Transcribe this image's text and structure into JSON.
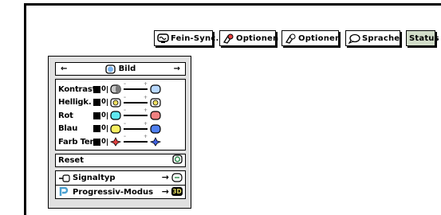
{
  "tabs": [
    {
      "id": "fein-sync",
      "label": "Fein-Sync.",
      "icon": "monitor-sync-icon"
    },
    {
      "id": "optionen1",
      "label": "Optionen",
      "icon": "tools-icon"
    },
    {
      "id": "optionen2",
      "label": "Optionen",
      "icon": "tools-icon"
    },
    {
      "id": "sprache",
      "label": "Sprache",
      "icon": "speech-bubble-icon"
    },
    {
      "id": "status",
      "label": "Status",
      "icon": ""
    }
  ],
  "menu": {
    "title": "Bild",
    "left_arrow": "←",
    "right_arrow": "→",
    "rows": [
      {
        "label": "Kontrast",
        "value": "0",
        "icon": "contrast-icon",
        "color": "#c8c8c8",
        "icon2_color": "#b8d8ff"
      },
      {
        "label": "Helligk.",
        "value": "0",
        "icon": "brightness-icon",
        "color": "#f0e060",
        "icon2_color": "#f0e060"
      },
      {
        "label": "Rot",
        "value": "0",
        "icon": "red-cyan-icon",
        "color": "#60e8f0",
        "icon2_color": "#f08080"
      },
      {
        "label": "Blau",
        "value": "0",
        "icon": "blue-yellow-icon",
        "color": "#f8f060",
        "icon2_color": "#5080f0"
      },
      {
        "label": "Farb Temp",
        "value": "0",
        "icon": "color-temp-icon",
        "color": "#e04040",
        "icon2_color": "#4060e0"
      }
    ],
    "reset_label": "Reset",
    "signaltyp_label": "Signaltyp",
    "progressiv_label": "Progressiv-Modus",
    "progressiv_badge": "3D",
    "arrow": "→"
  }
}
